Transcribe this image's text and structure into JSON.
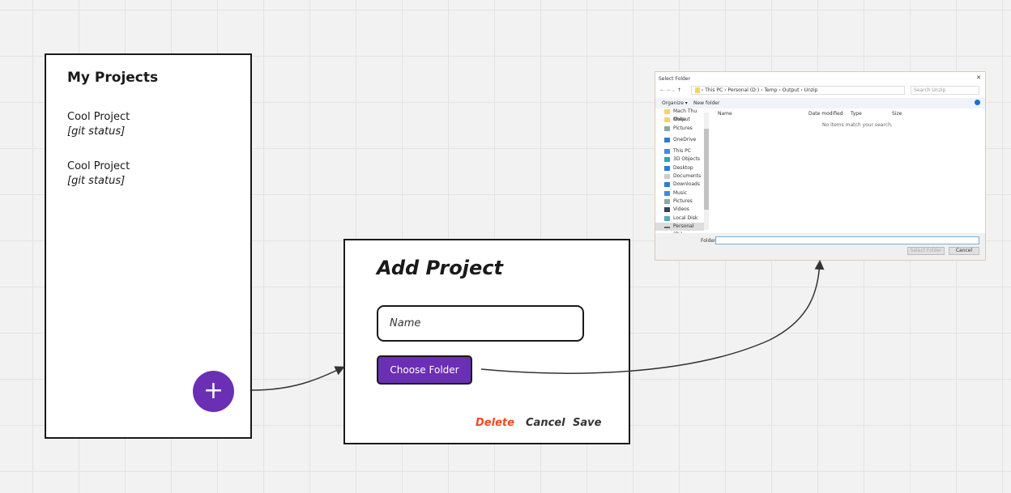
{
  "projects": {
    "title": "My Projects",
    "items": [
      {
        "name": "Cool Project",
        "status": "[git status]"
      },
      {
        "name": "Cool Project",
        "status": "[git status]"
      }
    ],
    "add_icon": "+"
  },
  "add_project": {
    "title": "Add Project",
    "name_placeholder": "Name",
    "choose_folder": "Choose Folder",
    "delete": "Delete",
    "cancel": "Cancel",
    "save": "Save"
  },
  "dialog": {
    "title": "Select Folder",
    "close": "✕",
    "breadcrumb": [
      "This PC",
      "Personal (D:)",
      "Temp",
      "Output",
      "Unzip"
    ],
    "search_placeholder": "Search Unzip",
    "organize": "Organize ▾",
    "new_folder": "New folder",
    "columns": [
      "Name",
      "Date modified",
      "Type",
      "Size"
    ],
    "empty": "No items match your search.",
    "tree": [
      "Mach Thu Khoa",
      "Output",
      "Pictures",
      "OneDrive",
      "This PC",
      "3D Objects",
      "Desktop",
      "Documents",
      "Downloads",
      "Music",
      "Pictures",
      "Videos",
      "Local Disk (C:)",
      "Personal (D:)"
    ],
    "folder_label": "Folder:",
    "select_folder": "Select Folder",
    "cancel": "Cancel"
  },
  "colors": {
    "accent": "#6a2fb5",
    "delete": "#f24726"
  }
}
